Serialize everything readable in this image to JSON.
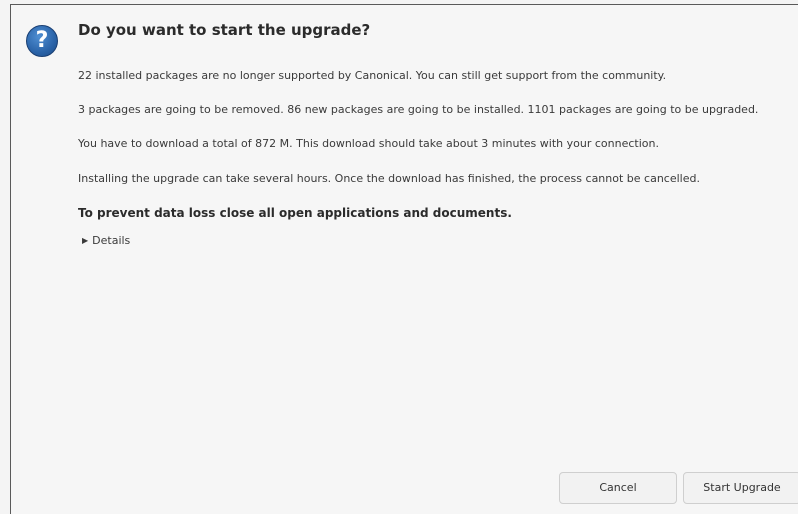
{
  "dialog": {
    "icon": "question-icon",
    "icon_glyph": "?",
    "title": "Do you want to start the upgrade?",
    "messages": [
      "22 installed packages are no longer supported by Canonical. You can still get support from the community.",
      "3 packages are going to be removed. 86 new packages are going to be installed. 1101 packages are going to be upgraded.",
      "You have to download a total of 872 M. This download should take about 3 minutes with your connection.",
      "Installing the upgrade can take several hours. Once the download has finished, the process cannot be cancelled."
    ],
    "warning": "To prevent data loss close all open applications and documents.",
    "details_label": "Details",
    "details_arrow": "▶"
  },
  "buttons": {
    "cancel_label": "Cancel",
    "start_label": "Start Upgrade"
  },
  "colors": {
    "icon_blue": "#2a63a8",
    "background": "#f6f6f6"
  }
}
